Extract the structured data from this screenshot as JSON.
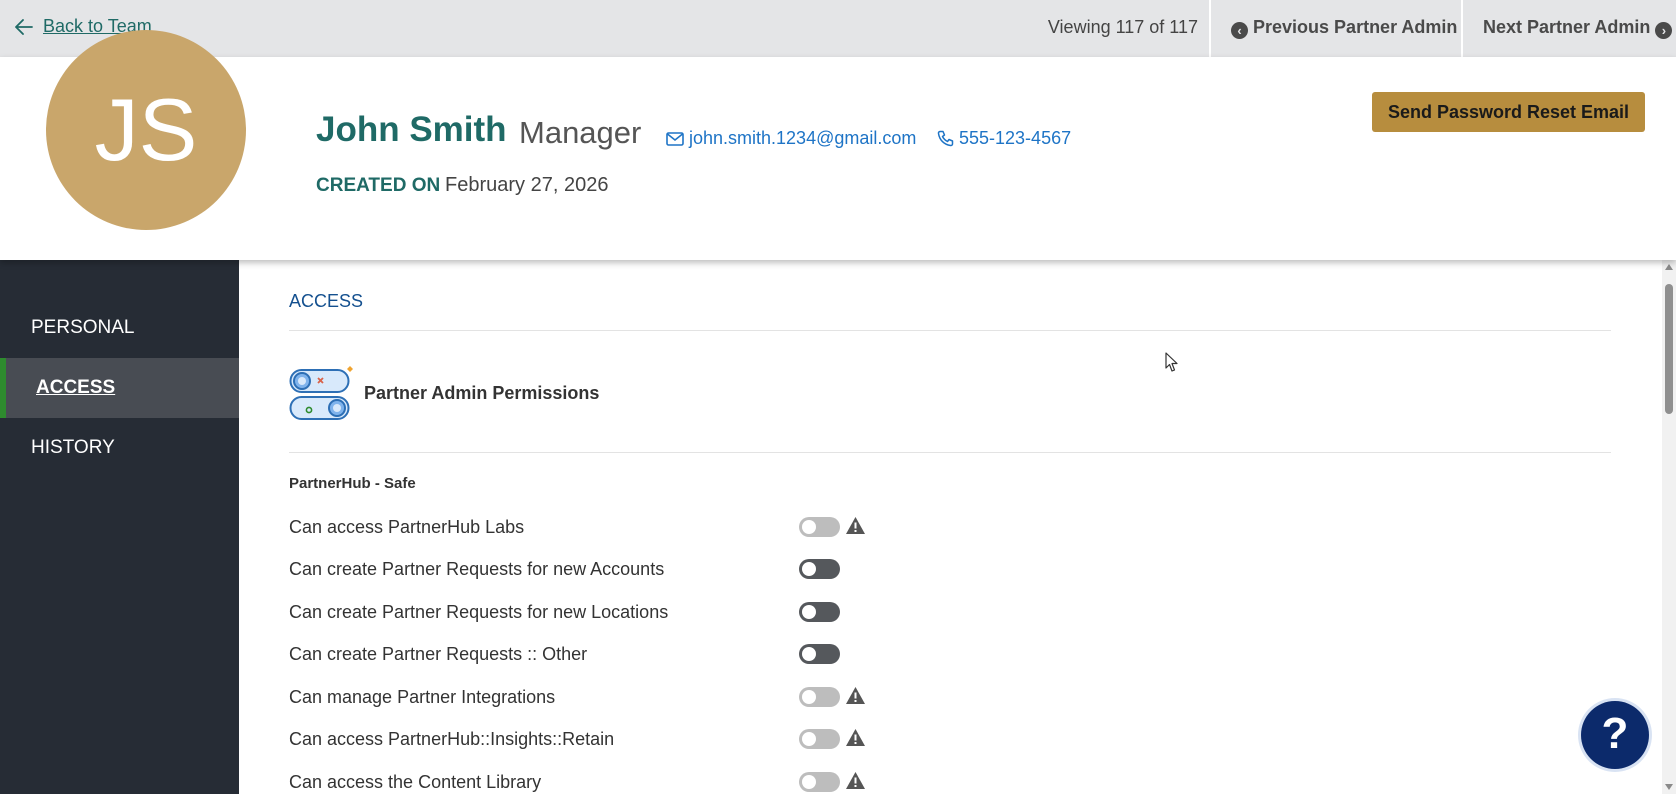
{
  "topbar": {
    "back_label": "Back to Team",
    "viewing_text": "Viewing 117 of 117",
    "prev_label": "Previous Partner Admin",
    "next_label": "Next Partner Admin"
  },
  "profile": {
    "initials": "JS",
    "name": "John Smith",
    "role": "Manager",
    "email": "john.smith.1234@gmail.com",
    "phone": "555-123-4567",
    "created_label": "CREATED ON",
    "created_date": "February 27, 2026",
    "reset_button": "Send Password Reset Email",
    "avatar_color": "#c9a66b"
  },
  "sidebar": {
    "items": [
      {
        "label": "PERSONAL",
        "active": false
      },
      {
        "label": "ACCESS",
        "active": true
      },
      {
        "label": "HISTORY",
        "active": false
      }
    ]
  },
  "access": {
    "section_title": "ACCESS",
    "permissions_title": "Partner Admin Permissions",
    "group_title": "PartnerHub - Safe",
    "permissions": [
      {
        "label": "Can access PartnerHub Labs",
        "state": "disabled",
        "warning": true
      },
      {
        "label": "Can create Partner Requests for new Accounts",
        "state": "enabled-off",
        "warning": false
      },
      {
        "label": "Can create Partner Requests for new Locations",
        "state": "enabled-off",
        "warning": false
      },
      {
        "label": "Can create Partner Requests :: Other",
        "state": "enabled-off",
        "warning": false
      },
      {
        "label": "Can manage Partner Integrations",
        "state": "disabled",
        "warning": true
      },
      {
        "label": "Can access PartnerHub::Insights::Retain",
        "state": "disabled",
        "warning": true
      },
      {
        "label": "Can access the Content Library",
        "state": "disabled",
        "warning": true
      }
    ]
  },
  "help": {
    "label": "?"
  },
  "colors": {
    "teal": "#1f6a66",
    "link_blue": "#1e74c6",
    "gold": "#b78d3e",
    "sidebar_bg": "#262c35",
    "active_indicator": "#2e8b2e",
    "section_blue": "#14508f",
    "help_navy": "#0c2a6b"
  }
}
